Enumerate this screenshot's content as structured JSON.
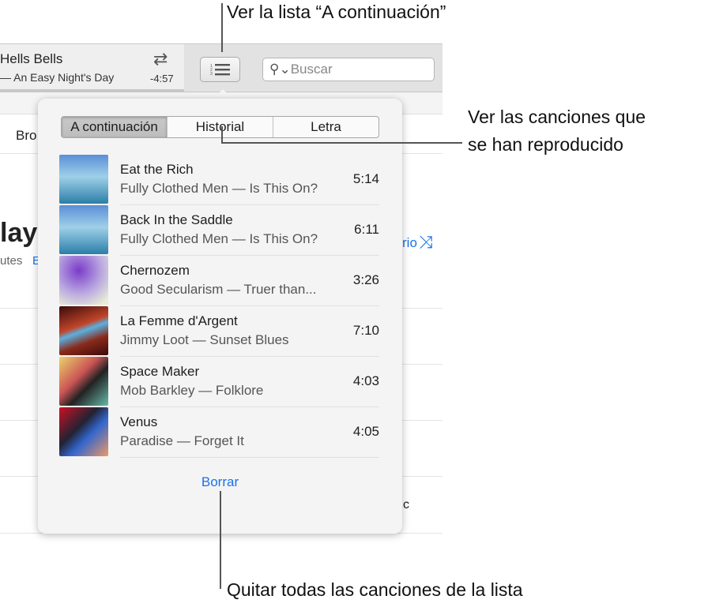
{
  "player": {
    "song": "Hells Bells",
    "artist_album": "— An Easy Night's Day",
    "time_remaining": "-4:57",
    "repeat_icon": "repeat-icon"
  },
  "toolbar": {
    "upnext_icon": "numbered-list-icon",
    "search_placeholder": "Buscar",
    "search_icon": "magnifier-dropdown-icon"
  },
  "background": {
    "nav_partial": "Bro",
    "title_partial": "layl",
    "meta_partial": "utes",
    "edit_partial": "E",
    "shuffle_partial": "rio",
    "shuffle_icon": "shuffle-icon",
    "genre_partial": "c"
  },
  "popover": {
    "tabs": [
      {
        "label": "A continuación",
        "active": true
      },
      {
        "label": "Historial",
        "active": false
      },
      {
        "label": "Letra",
        "active": false
      }
    ],
    "songs": [
      {
        "title": "Eat the Rich",
        "subtitle": "Fully Clothed Men — Is This On?",
        "duration": "5:14"
      },
      {
        "title": "Back In the Saddle",
        "subtitle": "Fully Clothed Men — Is This On?",
        "duration": "6:11"
      },
      {
        "title": "Chernozem",
        "subtitle": "Good Secularism — Truer than...",
        "duration": "3:26"
      },
      {
        "title": "La Femme d'Argent",
        "subtitle": "Jimmy Loot — Sunset Blues",
        "duration": "7:10"
      },
      {
        "title": "Space Maker",
        "subtitle": "Mob Barkley — Folklore",
        "duration": "4:03"
      },
      {
        "title": "Venus",
        "subtitle": "Paradise — Forget It",
        "duration": "4:05"
      }
    ],
    "clear_label": "Borrar"
  },
  "annotations": {
    "upnext": "Ver la lista “A continuación”",
    "history_line1": "Ver las canciones que",
    "history_line2": "se han reproducido",
    "clear": "Quitar todas las canciones de la lista"
  },
  "colors": {
    "accent": "#1a73e8"
  }
}
